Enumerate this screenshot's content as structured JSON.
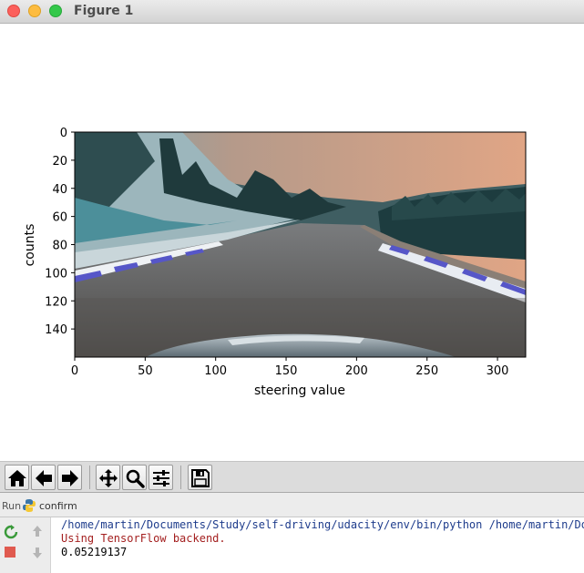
{
  "window": {
    "title": "Figure 1",
    "controls": [
      "close",
      "minimize",
      "maximize"
    ]
  },
  "chart_data": {
    "type": "image",
    "xlabel": "steering value",
    "ylabel": "counts",
    "xlim": [
      0,
      320
    ],
    "ylim": [
      160,
      0
    ],
    "xticks": [
      0,
      50,
      100,
      150,
      200,
      250,
      300
    ],
    "yticks": [
      0,
      20,
      40,
      60,
      80,
      100,
      120,
      140
    ],
    "image_content": "dashcam road scene with trees, curbs and car hood",
    "colors": {
      "sky": "#d4a184",
      "road": "#6a6a6a",
      "trees": "#1f3b3a",
      "curb_blue": "#5a5ac8"
    }
  },
  "toolbar": {
    "buttons": [
      {
        "name": "home",
        "icon": "home-icon"
      },
      {
        "name": "back",
        "icon": "arrow-left-icon"
      },
      {
        "name": "forward",
        "icon": "arrow-right-icon"
      },
      {
        "name": "pan",
        "icon": "move-icon"
      },
      {
        "name": "zoom",
        "icon": "magnifier-icon"
      },
      {
        "name": "subplots",
        "icon": "sliders-icon"
      },
      {
        "name": "save",
        "icon": "floppy-icon"
      }
    ]
  },
  "run_panel": {
    "label": "Run",
    "config_name": "confirm",
    "console_lines": [
      {
        "kind": "command",
        "text": "/home/martin/Documents/Study/self-driving/udacity/env/bin/python /home/martin/Docu"
      },
      {
        "kind": "stderr",
        "text": "Using TensorFlow backend."
      },
      {
        "kind": "stdout",
        "text": "0.05219137"
      }
    ]
  }
}
